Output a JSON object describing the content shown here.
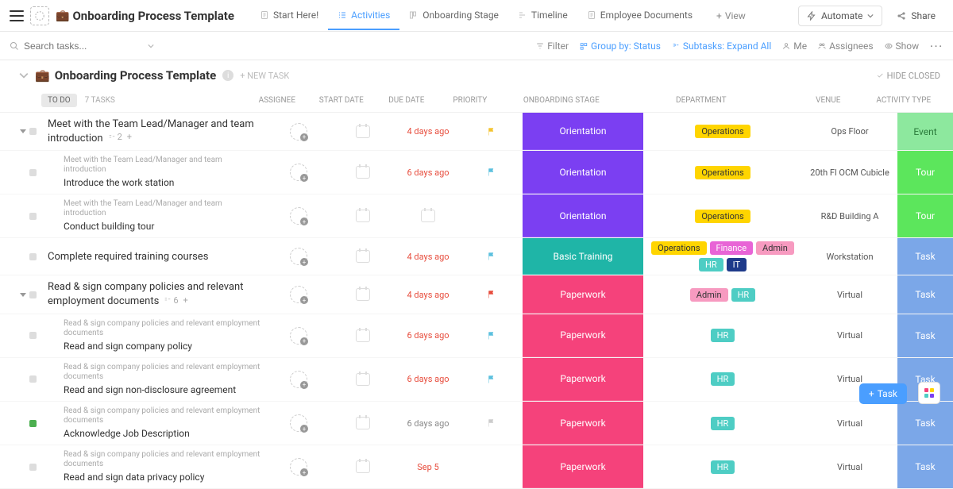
{
  "header": {
    "title": "Onboarding Process Template",
    "briefcase": "💼"
  },
  "views": [
    {
      "label": "Start Here!",
      "icon": "doc"
    },
    {
      "label": "Activities",
      "icon": "list",
      "active": true
    },
    {
      "label": "Onboarding Stage",
      "icon": "board"
    },
    {
      "label": "Timeline",
      "icon": "gantt"
    },
    {
      "label": "Employee Documents",
      "icon": "doc"
    }
  ],
  "add_view_label": "View",
  "top_buttons": {
    "automate": "Automate",
    "share": "Share"
  },
  "toolbar": {
    "search_placeholder": "Search tasks...",
    "filter": "Filter",
    "group_by": "Group by: Status",
    "subtasks": "Subtasks: Expand All",
    "me": "Me",
    "assignees": "Assignees",
    "show": "Show"
  },
  "list": {
    "title": "Onboarding Process Template",
    "new_task": "+ NEW TASK",
    "hide_closed": "HIDE CLOSED",
    "status_label": "TO DO",
    "task_count": "7 TASKS"
  },
  "columns": [
    "ASSIGNEE",
    "START DATE",
    "DUE DATE",
    "PRIORITY",
    "ONBOARDING STAGE",
    "DEPARTMENT",
    "VENUE",
    "ACTIVITY TYPE"
  ],
  "tasks": [
    {
      "name": "Meet with the Team Lead/Manager and team introduction",
      "sub_count": "2",
      "due": "4 days ago",
      "due_cls": "due-red",
      "flag": "yellow",
      "stage": "Orientation",
      "stage_cls": "stage-purple",
      "dept": [
        {
          "t": "Operations",
          "c": "tag-ops"
        }
      ],
      "venue": "Ops Floor",
      "activity": "Event",
      "act_cls": "act-event",
      "expandable": true,
      "children": [
        {
          "parent": "Meet with the Team Lead/Manager and team introduction",
          "name": "Introduce the work station",
          "due": "6 days ago",
          "due_cls": "due-red",
          "flag": "blue",
          "stage": "Orientation",
          "stage_cls": "stage-purple",
          "dept": [
            {
              "t": "Operations",
              "c": "tag-ops"
            }
          ],
          "venue": "20th Fl OCM Cubicle",
          "activity": "Tour",
          "act_cls": "act-tour"
        },
        {
          "parent": "Meet with the Team Lead/Manager and team introduction",
          "name": "Conduct building tour",
          "due": "",
          "due_cls": "",
          "flag": "",
          "stage": "Orientation",
          "stage_cls": "stage-purple",
          "dept": [
            {
              "t": "Operations",
              "c": "tag-ops"
            }
          ],
          "venue": "R&D Building A",
          "activity": "Tour",
          "act_cls": "act-tour",
          "show_cal_due": true
        }
      ]
    },
    {
      "name": "Complete required training courses",
      "due": "4 days ago",
      "due_cls": "due-red",
      "flag": "blue",
      "stage": "Basic Training",
      "stage_cls": "stage-teal",
      "dept": [
        {
          "t": "Operations",
          "c": "tag-ops"
        },
        {
          "t": "Finance",
          "c": "tag-fin"
        },
        {
          "t": "Admin",
          "c": "tag-admin"
        },
        {
          "t": "HR",
          "c": "tag-hr"
        },
        {
          "t": "IT",
          "c": "tag-it"
        }
      ],
      "venue": "Workstation",
      "activity": "Task",
      "act_cls": "act-task"
    },
    {
      "name": "Read & sign company policies and relevant employment documents",
      "sub_count": "6",
      "due": "4 days ago",
      "due_cls": "due-red",
      "flag": "red",
      "stage": "Paperwork",
      "stage_cls": "stage-pink",
      "dept": [
        {
          "t": "Admin",
          "c": "tag-admin"
        },
        {
          "t": "HR",
          "c": "tag-hr"
        }
      ],
      "venue": "Virtual",
      "activity": "Task",
      "act_cls": "act-task",
      "expandable": true,
      "children": [
        {
          "parent": "Read & sign company policies and relevant employment documents",
          "name": "Read and sign company policy",
          "due": "6 days ago",
          "due_cls": "due-red",
          "flag": "blue",
          "stage": "Paperwork",
          "stage_cls": "stage-pink",
          "dept": [
            {
              "t": "HR",
              "c": "tag-hr"
            }
          ],
          "venue": "Virtual",
          "activity": "Task",
          "act_cls": "act-task"
        },
        {
          "parent": "Read & sign company policies and relevant employment documents",
          "name": "Read and sign non-disclosure agreement",
          "due": "6 days ago",
          "due_cls": "due-red",
          "flag": "blue",
          "stage": "Paperwork",
          "stage_cls": "stage-pink",
          "dept": [
            {
              "t": "HR",
              "c": "tag-hr"
            }
          ],
          "venue": "Virtual",
          "activity": "Task",
          "act_cls": "act-task"
        },
        {
          "parent": "Read & sign company policies and relevant employment documents",
          "name": "Acknowledge Job Description",
          "due": "6 days ago",
          "due_cls": "due-gray",
          "flag": "gray",
          "stage": "Paperwork",
          "stage_cls": "stage-pink",
          "dept": [
            {
              "t": "HR",
              "c": "tag-hr"
            }
          ],
          "venue": "Virtual",
          "activity": "Task",
          "act_cls": "act-task",
          "status_green": true
        },
        {
          "parent": "Read & sign company policies and relevant employment documents",
          "name": "Read and sign data privacy policy",
          "due": "Sep 5",
          "due_cls": "due-red",
          "flag": "",
          "stage": "Paperwork",
          "stage_cls": "stage-pink",
          "dept": [
            {
              "t": "HR",
              "c": "tag-hr"
            }
          ],
          "venue": "Virtual",
          "activity": "Task",
          "act_cls": "act-task"
        }
      ]
    }
  ],
  "float": {
    "task": "Task"
  }
}
